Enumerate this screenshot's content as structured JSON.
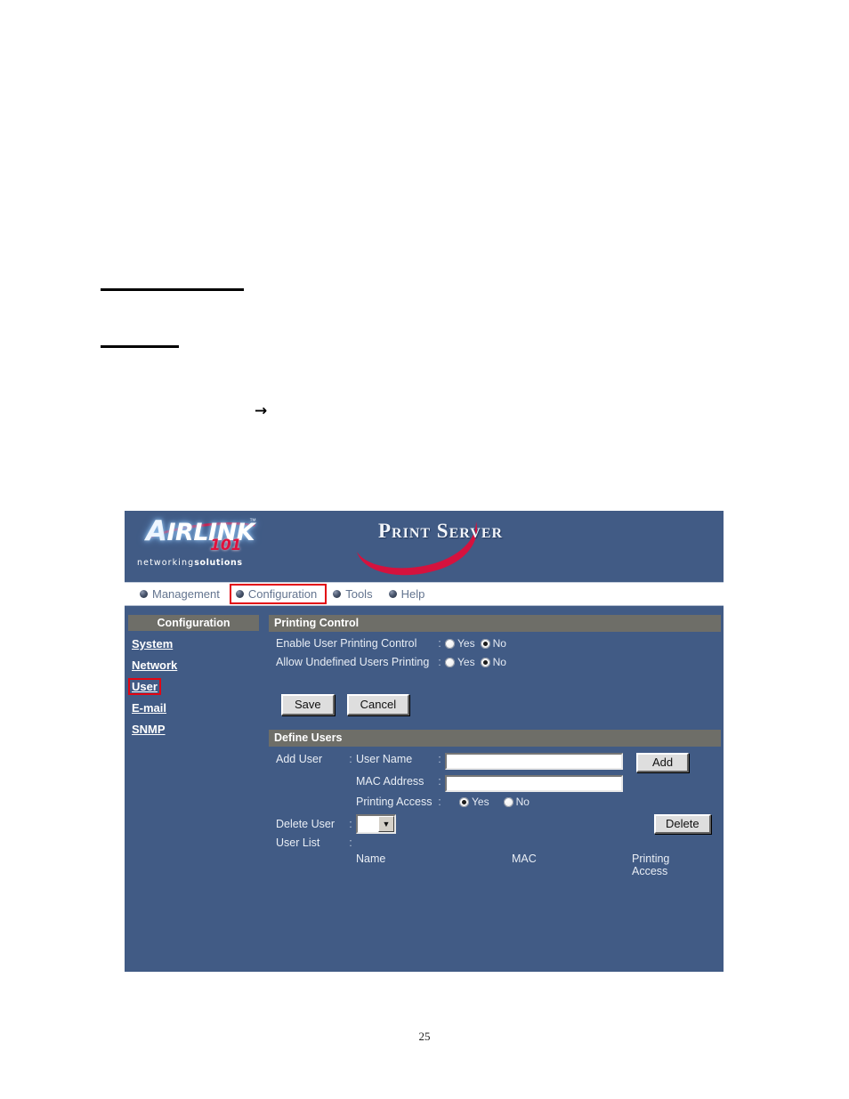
{
  "document": {
    "page_number": "25",
    "arrow_glyph": "→"
  },
  "print_server_ui": {
    "banner": {
      "logo_brand": "IRLINK",
      "logo_cap": "A",
      "logo_tm": "™",
      "logo_model": "101",
      "logo_tagline_light": "networking",
      "logo_tagline_bold": "solutions",
      "title": "Print Server"
    },
    "nav": {
      "items": [
        {
          "label": "Management",
          "highlighted": false
        },
        {
          "label": "Configuration",
          "highlighted": true
        },
        {
          "label": "Tools",
          "highlighted": false
        },
        {
          "label": "Help",
          "highlighted": false
        }
      ]
    },
    "sidebar": {
      "header": "Configuration",
      "items": [
        {
          "label": "System",
          "highlighted": false
        },
        {
          "label": "Network",
          "highlighted": false
        },
        {
          "label": "User",
          "highlighted": true
        },
        {
          "label": "E-mail",
          "highlighted": false
        },
        {
          "label": "SNMP",
          "highlighted": false
        }
      ]
    },
    "printing_control": {
      "section_title": "Printing Control",
      "rows": [
        {
          "label": "Enable User Printing Control",
          "colon": ":",
          "yes_label": "Yes",
          "no_label": "No",
          "selected": "No"
        },
        {
          "label": "Allow Undefined Users Printing",
          "colon": ":",
          "yes_label": "Yes",
          "no_label": "No",
          "selected": "No"
        }
      ],
      "save_label": "Save",
      "cancel_label": "Cancel"
    },
    "define_users": {
      "section_title": "Define Users",
      "add_user_label": "Add User",
      "colon": ":",
      "user_name_label": "User Name",
      "user_name_value": "",
      "mac_address_label": "MAC Address",
      "mac_address_value": "",
      "printing_access_label": "Printing Access",
      "printing_access_yes": "Yes",
      "printing_access_no": "No",
      "printing_access_selected": "Yes",
      "add_button_label": "Add",
      "delete_user_label": "Delete User",
      "delete_user_value": "",
      "delete_button_label": "Delete",
      "user_list_label": "User List",
      "user_list_columns": [
        "Name",
        "MAC",
        "Printing Access"
      ],
      "user_list_rows": []
    },
    "colors": {
      "panel_blue": "#415b85",
      "section_grey": "#6e6e68",
      "highlight_red": "#e30613",
      "logo_red": "#d5123e",
      "nav_bg": "#ffffff",
      "nav_text": "#63748f"
    }
  }
}
